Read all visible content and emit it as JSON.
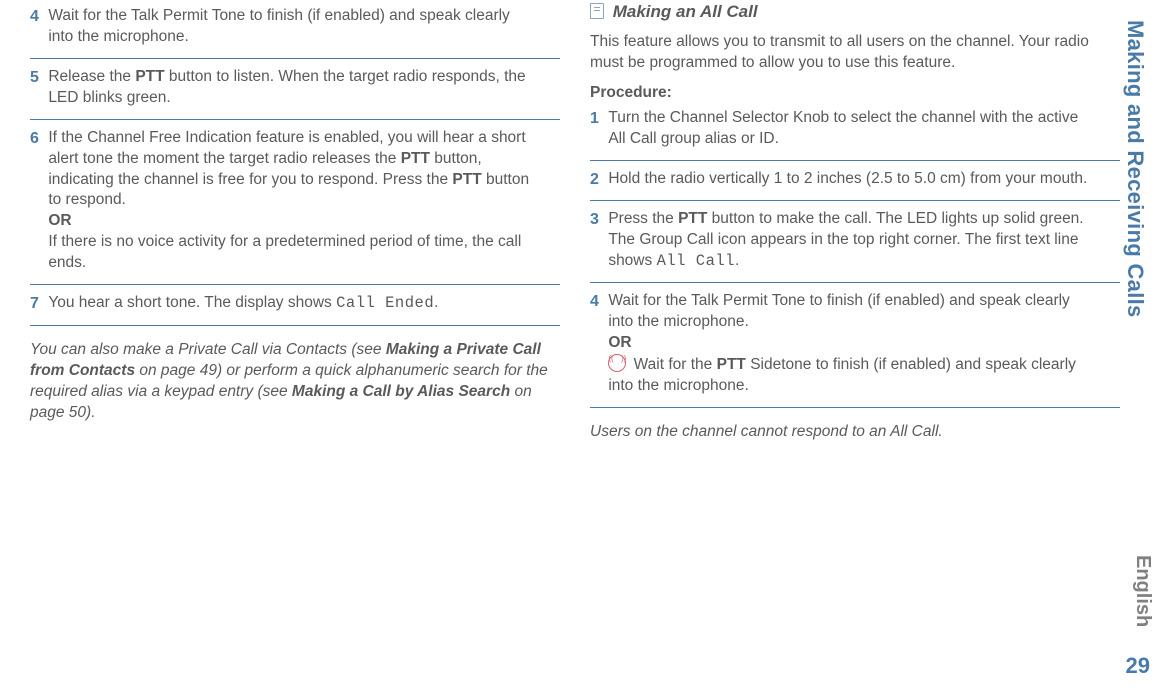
{
  "left": {
    "steps": [
      {
        "num": "4",
        "text": "Wait for the Talk Permit Tone to finish (if enabled) and speak clearly into the microphone."
      },
      {
        "num": "5",
        "prefix": "Release the ",
        "bold1": "PTT",
        "text": " button to listen. When the target radio responds, the LED blinks green."
      },
      {
        "num": "6",
        "text_a": "If the Channel Free Indication feature is enabled, you will hear a short alert tone the moment the target radio releases the ",
        "bold1": "PTT",
        "text_b": " button, indicating the channel is free for you to respond. Press the ",
        "bold2": "PTT",
        "text_c": " button to respond.",
        "or": "OR",
        "text_d": "If there is no voice activity for a predetermined period of time, the call ends."
      },
      {
        "num": "7",
        "text_a": "You hear a short tone. The display shows ",
        "mono": "Call Ended",
        "text_b": "."
      }
    ],
    "note": {
      "a": "You can also make a Private Call via Contacts (see ",
      "b1": "Making a Private Call from Contacts",
      "c": " on page 49) or perform a quick alphanumeric search for the required alias via a keypad entry (see ",
      "b2": "Making a Call by Alias Search",
      "d": " on page 50)."
    }
  },
  "right": {
    "heading": "Making an All Call",
    "intro": "This feature allows you to transmit to all users on the channel. Your radio must be programmed to allow you to use this feature.",
    "procedure": "Procedure:",
    "steps": [
      {
        "num": "1",
        "text": "Turn the Channel Selector Knob to select the channel with the active All Call group alias or ID."
      },
      {
        "num": "2",
        "text": "Hold the radio vertically 1 to 2 inches (2.5 to 5.0 cm) from your mouth."
      },
      {
        "num": "3",
        "text_a": "Press the ",
        "bold1": "PTT",
        "text_b": " button to make the call. The LED lights up solid green. The Group Call icon appears in the top right corner. The first text line shows ",
        "mono": "All Call",
        "text_c": "."
      },
      {
        "num": "4",
        "text_a": "Wait for the Talk Permit Tone to finish (if enabled) and speak clearly into the microphone.",
        "or": "OR",
        "text_b": " Wait for the ",
        "bold1": "PTT",
        "text_c": " Sidetone to finish (if enabled) and speak clearly into the microphone."
      }
    ],
    "footer": "Users on the channel cannot respond to an All Call."
  },
  "side": {
    "label": "Making and Receiving Calls",
    "lang": "English",
    "page": "29"
  }
}
